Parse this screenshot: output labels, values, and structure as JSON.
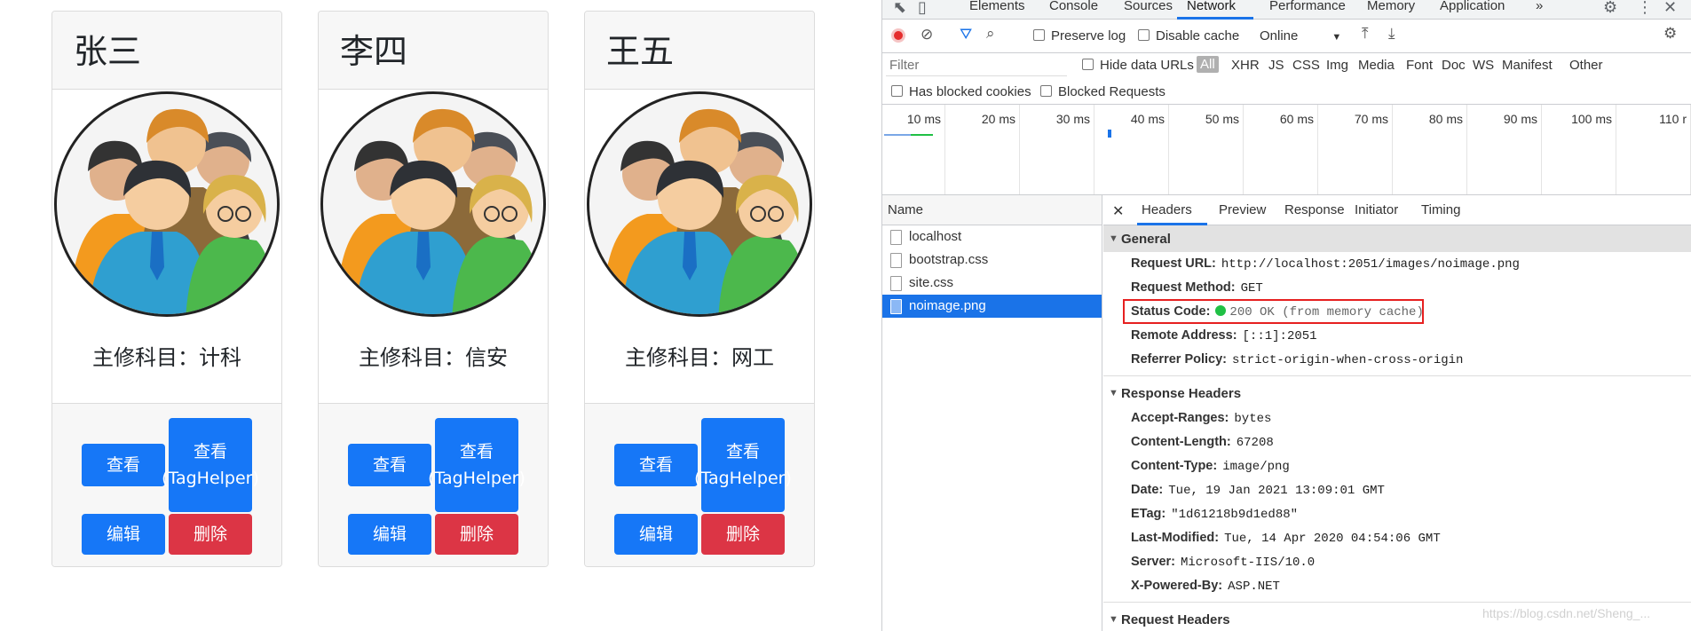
{
  "cards": [
    {
      "name": "张三",
      "major": "主修科目：计科",
      "view": "查看",
      "view_tag": "查看 (TagHelper)",
      "edit": "编辑",
      "delete": "删除"
    },
    {
      "name": "李四",
      "major": "主修科目：信安",
      "view": "查看",
      "view_tag": "查看 (TagHelper)",
      "edit": "编辑",
      "delete": "删除"
    },
    {
      "name": "王五",
      "major": "主修科目：网工",
      "view": "查看",
      "view_tag": "查看 (TagHelper)",
      "edit": "编辑",
      "delete": "删除"
    }
  ],
  "devtools": {
    "tabs": [
      "Elements",
      "Console",
      "Sources",
      "Network",
      "Performance",
      "Memory",
      "Application"
    ],
    "active_tab": "Network",
    "more": "»",
    "toolbar": {
      "preserve_log": "Preserve log",
      "disable_cache": "Disable cache",
      "throttle": "Online"
    },
    "filter": {
      "placeholder": "Filter",
      "hide_data_urls": "Hide data URLs",
      "types": [
        "All",
        "XHR",
        "JS",
        "CSS",
        "Img",
        "Media",
        "Font",
        "Doc",
        "WS",
        "Manifest",
        "Other"
      ]
    },
    "blocked": {
      "has_blocked_cookies": "Has blocked cookies",
      "blocked_requests": "Blocked Requests"
    },
    "timeline_ticks": [
      "10 ms",
      "20 ms",
      "30 ms",
      "40 ms",
      "50 ms",
      "60 ms",
      "70 ms",
      "80 ms",
      "90 ms",
      "100 ms",
      "110 r"
    ],
    "name_header": "Name",
    "requests": [
      "localhost",
      "bootstrap.css",
      "site.css",
      "noimage.png"
    ],
    "selected_request": "noimage.png",
    "detail_tabs": [
      "Headers",
      "Preview",
      "Response",
      "Initiator",
      "Timing"
    ],
    "general": {
      "title": "General",
      "request_url_k": "Request URL:",
      "request_url_v": "http://localhost:2051/images/noimage.png",
      "method_k": "Request Method:",
      "method_v": "GET",
      "status_k": "Status Code:",
      "status_v": "200 OK (from memory cache)",
      "remote_k": "Remote Address:",
      "remote_v": "[::1]:2051",
      "referrer_k": "Referrer Policy:",
      "referrer_v": "strict-origin-when-cross-origin"
    },
    "response_headers": {
      "title": "Response Headers",
      "rows": [
        {
          "k": "Accept-Ranges:",
          "v": "bytes"
        },
        {
          "k": "Content-Length:",
          "v": "67208"
        },
        {
          "k": "Content-Type:",
          "v": "image/png"
        },
        {
          "k": "Date:",
          "v": "Tue, 19 Jan 2021 13:09:01 GMT"
        },
        {
          "k": "ETag:",
          "v": "\"1d61218b9d1ed88\""
        },
        {
          "k": "Last-Modified:",
          "v": "Tue, 14 Apr 2020 04:54:06 GMT"
        },
        {
          "k": "Server:",
          "v": "Microsoft-IIS/10.0"
        },
        {
          "k": "X-Powered-By:",
          "v": "ASP.NET"
        }
      ]
    },
    "request_headers_title": "Request Headers"
  },
  "watermark": "https://blog.csdn.net/Sheng_..."
}
